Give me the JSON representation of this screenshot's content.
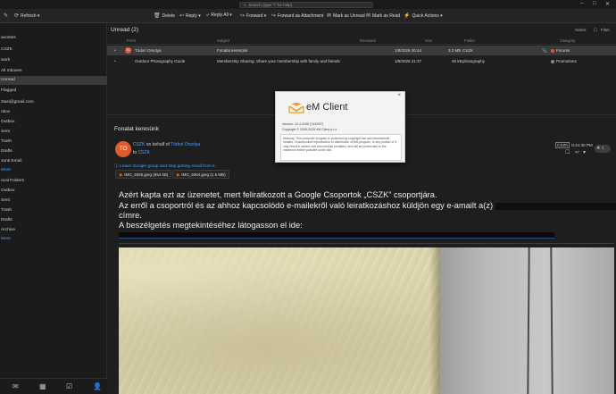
{
  "titlebar": {
    "search_placeholder": "Search (type '?' for help)"
  },
  "toolbar": {
    "refresh": "Refresh",
    "delete": "Delete",
    "reply": "Reply",
    "reply_all": "Reply All",
    "forward": "Forward",
    "forward_attachment": "Forward as Attachment",
    "mark_unread": "Mark as Unread",
    "mark_read": "Mark as Read",
    "quick_actions": "Quick Actions"
  },
  "sidebar": {
    "items": [
      "avorites",
      "CSZK",
      "work",
      "All Inboxes",
      "Unread",
      "Flagged",
      "ztasi@gmail.com",
      "nbox",
      "Outbox",
      "Sent",
      "Trash",
      "Drafts",
      "Junk Email",
      "More",
      "ocal Folders",
      "Outbox",
      "Sent",
      "Trash",
      "Drafts",
      "Archive",
      "More"
    ]
  },
  "list": {
    "title": "Unread",
    "count": "(2)",
    "select": "Select",
    "filter": "Filter",
    "columns": {
      "from": "From",
      "subject": "Subject",
      "received": "Received",
      "size": "Size",
      "folder": "Folder",
      "category": "Category"
    },
    "rows": [
      {
        "avatar": "TO",
        "from": "Tódori Orsolya",
        "subject": "Fonalat keresünk",
        "received": "1/8/2026 20:44",
        "size": "3.2 MB",
        "folder": "CSZK",
        "category": "Forums"
      },
      {
        "avatar": "",
        "from": "Outdoor Photography Guide",
        "subject": "Membership Sharing: Share your membership with family and friends",
        "received": "1/8/2026 21:37",
        "size": "46 kB",
        "folder": "photography",
        "category": "Promotions"
      }
    ]
  },
  "message": {
    "subject": "Fonalat keresünk",
    "avatar": "TO",
    "sender_group": "CSZK",
    "on_behalf": "on behalf of",
    "sender_person": "Tódori Orsolya",
    "to_label": "to",
    "to": "CSZK",
    "info": "Leave Google group and stop getting email from it.",
    "attachments": [
      {
        "name": "IMG_9365.jpeg",
        "size": "(854 kB)"
      },
      {
        "name": "IMG_9364.jpeg",
        "size": "(1.5 MB)"
      }
    ],
    "badge": "CSZK",
    "time": "8:44:30 PM",
    "body": [
      "Azért kapta ezt az üzenetet, mert feliratkozott a Google Csoportok „CSZK” csoportjára.",
      "Az erről a csoportról és az ahhoz kapcsolódó e-mailekről való leiratkozáshoz küldjön egy e-amailt a(z)",
      "címre.",
      "A beszélgetés megtekintéséhez látogasson el ide:"
    ]
  },
  "dialog": {
    "title": "eM Client",
    "version_label": "Version:",
    "version": "10.4.4195 (7d32f97)",
    "copyright": "Copyright © 2006-2025 eM Client s.r.o.",
    "warning": "Warning: This computer program is protected by copyright law and international treaties. Unauthorized reproduction or distribution of this program, or any portion of it, may result in severe civil and criminal penalties, and will be prosecuted to the maximum extent possible under law.",
    "close": "×"
  }
}
